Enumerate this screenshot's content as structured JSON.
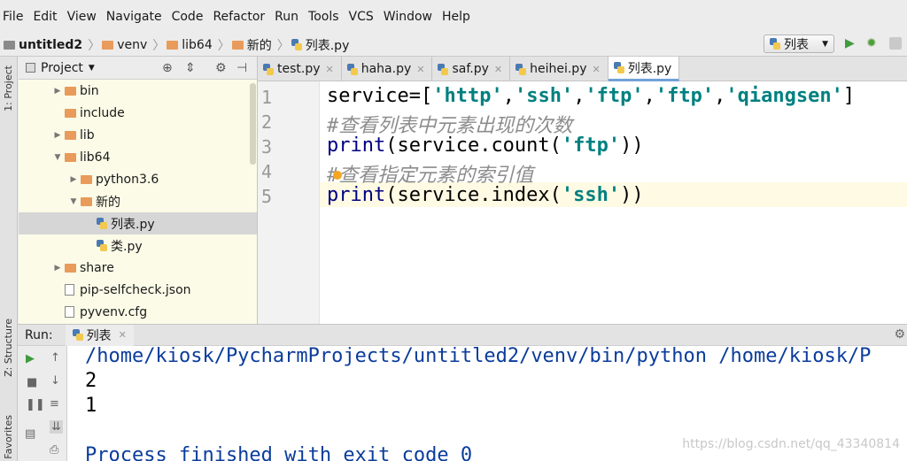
{
  "menu": [
    "File",
    "Edit",
    "View",
    "Navigate",
    "Code",
    "Refactor",
    "Run",
    "Tools",
    "VCS",
    "Window",
    "Help"
  ],
  "breadcrumb": [
    "untitled2",
    "venv",
    "lib64",
    "新的",
    "列表.py"
  ],
  "run_config": "列表",
  "left_tabs": {
    "project": "1: Project",
    "structure": "Z: Structure",
    "favorites": "Favorites"
  },
  "project_panel": {
    "title": "Project",
    "items": [
      {
        "label": "bin",
        "indent": 0,
        "arrow": "▶",
        "type": "folder"
      },
      {
        "label": "include",
        "indent": 0,
        "arrow": "",
        "type": "folder"
      },
      {
        "label": "lib",
        "indent": 0,
        "arrow": "▶",
        "type": "folder"
      },
      {
        "label": "lib64",
        "indent": 0,
        "arrow": "▼",
        "type": "folder"
      },
      {
        "label": "python3.6",
        "indent": 1,
        "arrow": "▶",
        "type": "folder"
      },
      {
        "label": "新的",
        "indent": 1,
        "arrow": "▼",
        "type": "folder"
      },
      {
        "label": "列表.py",
        "indent": 2,
        "arrow": "",
        "type": "py",
        "selected": true
      },
      {
        "label": "类.py",
        "indent": 2,
        "arrow": "",
        "type": "py"
      },
      {
        "label": "share",
        "indent": 0,
        "arrow": "▶",
        "type": "folder"
      },
      {
        "label": "pip-selfcheck.json",
        "indent": 0,
        "arrow": "",
        "type": "file"
      },
      {
        "label": "pyvenv.cfg",
        "indent": 0,
        "arrow": "",
        "type": "file"
      }
    ]
  },
  "tabs": [
    {
      "label": "test.py",
      "active": false
    },
    {
      "label": "haha.py",
      "active": false
    },
    {
      "label": "saf.py",
      "active": false
    },
    {
      "label": "heihei.py",
      "active": false
    },
    {
      "label": "列表.py",
      "active": true
    }
  ],
  "code_lines": [
    {
      "num": "1",
      "tokens": [
        [
          "n",
          "service=["
        ],
        [
          "s",
          "'http'"
        ],
        [
          "n",
          ","
        ],
        [
          "s",
          "'ssh'"
        ],
        [
          "n",
          ","
        ],
        [
          "s",
          "'ftp'"
        ],
        [
          "n",
          ","
        ],
        [
          "s",
          "'ftp'"
        ],
        [
          "n",
          ","
        ],
        [
          "s",
          "'qiangsen'"
        ],
        [
          "n",
          "]"
        ]
      ]
    },
    {
      "num": "2",
      "tokens": [
        [
          "c",
          "#查看列表中元素出现的次数"
        ]
      ]
    },
    {
      "num": "3",
      "tokens": [
        [
          "k",
          "print"
        ],
        [
          "n",
          "(service.count("
        ],
        [
          "s",
          "'ftp'"
        ],
        [
          "n",
          "))"
        ]
      ]
    },
    {
      "num": "4",
      "tokens": [
        [
          "c",
          "#查看指定元素的索引值"
        ]
      ]
    },
    {
      "num": "5",
      "tokens": [
        [
          "k",
          "print"
        ],
        [
          "n",
          "(service.index("
        ],
        [
          "s",
          "'ssh'"
        ],
        [
          "n",
          "))"
        ]
      ]
    }
  ],
  "run_panel": {
    "label": "Run:",
    "tab": "列表",
    "console": [
      {
        "text": "/home/kiosk/PycharmProjects/untitled2/venv/bin/python /home/kiosk/P",
        "kind": "cmd"
      },
      {
        "text": "2",
        "kind": "out"
      },
      {
        "text": "1",
        "kind": "out"
      },
      {
        "text": "",
        "kind": "out"
      },
      {
        "text": "Process finished with exit code 0",
        "kind": "cmd"
      }
    ]
  },
  "watermark": "https://blog.csdn.net/qq_43340814"
}
